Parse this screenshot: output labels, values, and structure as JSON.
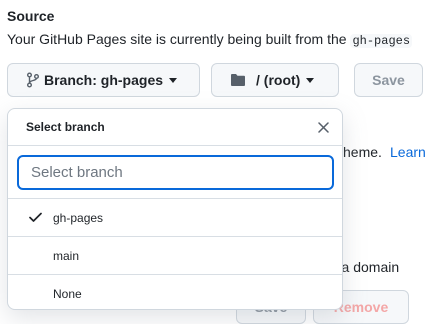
{
  "source": {
    "title": "Source",
    "description": "Your GitHub Pages site is currently being built from the ",
    "description_code": "gh-pages"
  },
  "toolbar": {
    "branch_label": "Branch: gh-pages",
    "folder_label": "/ (root)",
    "save_label": "Save"
  },
  "background": {
    "theme_text": "heme.",
    "learn_text": "Learn",
    "domain_text": "m a domain",
    "save_label": "Save",
    "remove_label": "Remove"
  },
  "dropdown": {
    "title": "Select branch",
    "filter_placeholder": "Select branch",
    "items": [
      {
        "label": "gh-pages",
        "selected": true
      },
      {
        "label": "main",
        "selected": false
      },
      {
        "label": "None",
        "selected": false
      }
    ]
  },
  "colors": {
    "accent": "#0969da",
    "danger_muted": "#f4a7a7",
    "border": "#d0d7de"
  }
}
